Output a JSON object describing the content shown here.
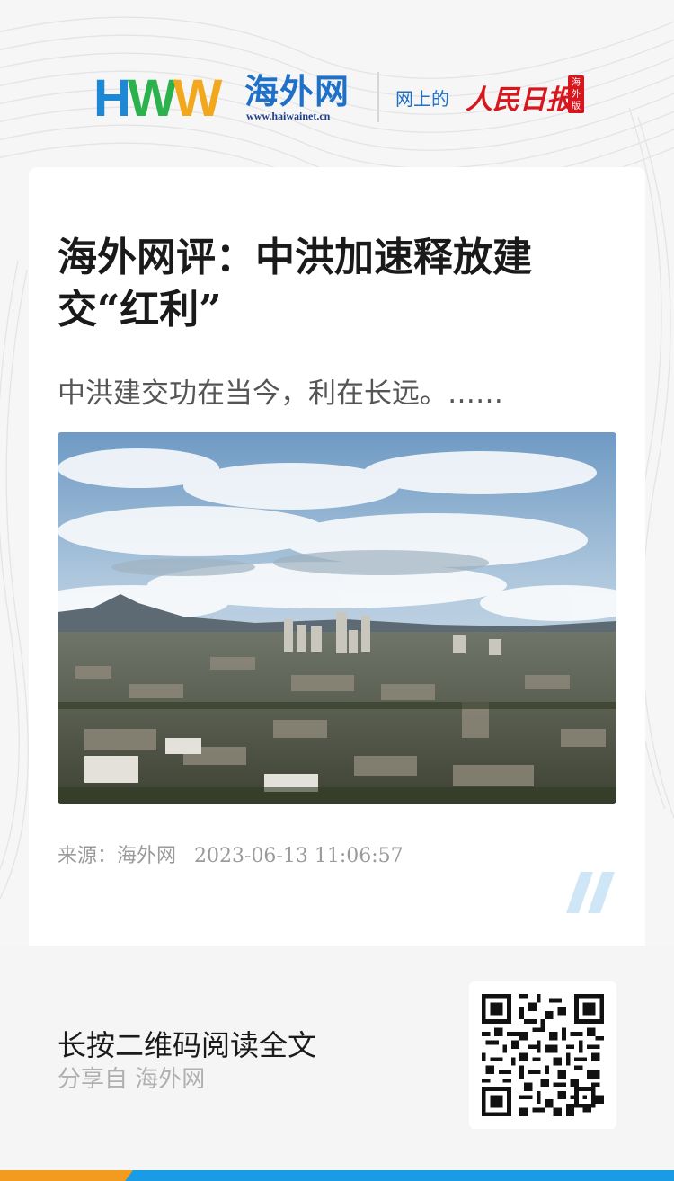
{
  "header": {
    "logo_letters": [
      "H",
      "W",
      "W"
    ],
    "logo_cn": "海外网",
    "logo_url": "www.haiwainet.cn",
    "slogan_prefix": "网上的",
    "slogan_brand": "人民日报",
    "badge": "海外版"
  },
  "article": {
    "title": "海外网评：中洪加速释放建交“红利”",
    "summary": "中洪建交功在当今，利在长远。……",
    "image_alt": "city-skyline-photo",
    "source": "来源：海外网",
    "timestamp": "2023-06-13 11:06:57"
  },
  "footer": {
    "cta": "长按二维码阅读全文",
    "share": "分享自 海外网"
  },
  "colors": {
    "brand_blue": "#1e70c8",
    "brand_red": "#d7161e",
    "accent_orange": "#f39b1e",
    "accent_sky": "#1a9be6"
  }
}
